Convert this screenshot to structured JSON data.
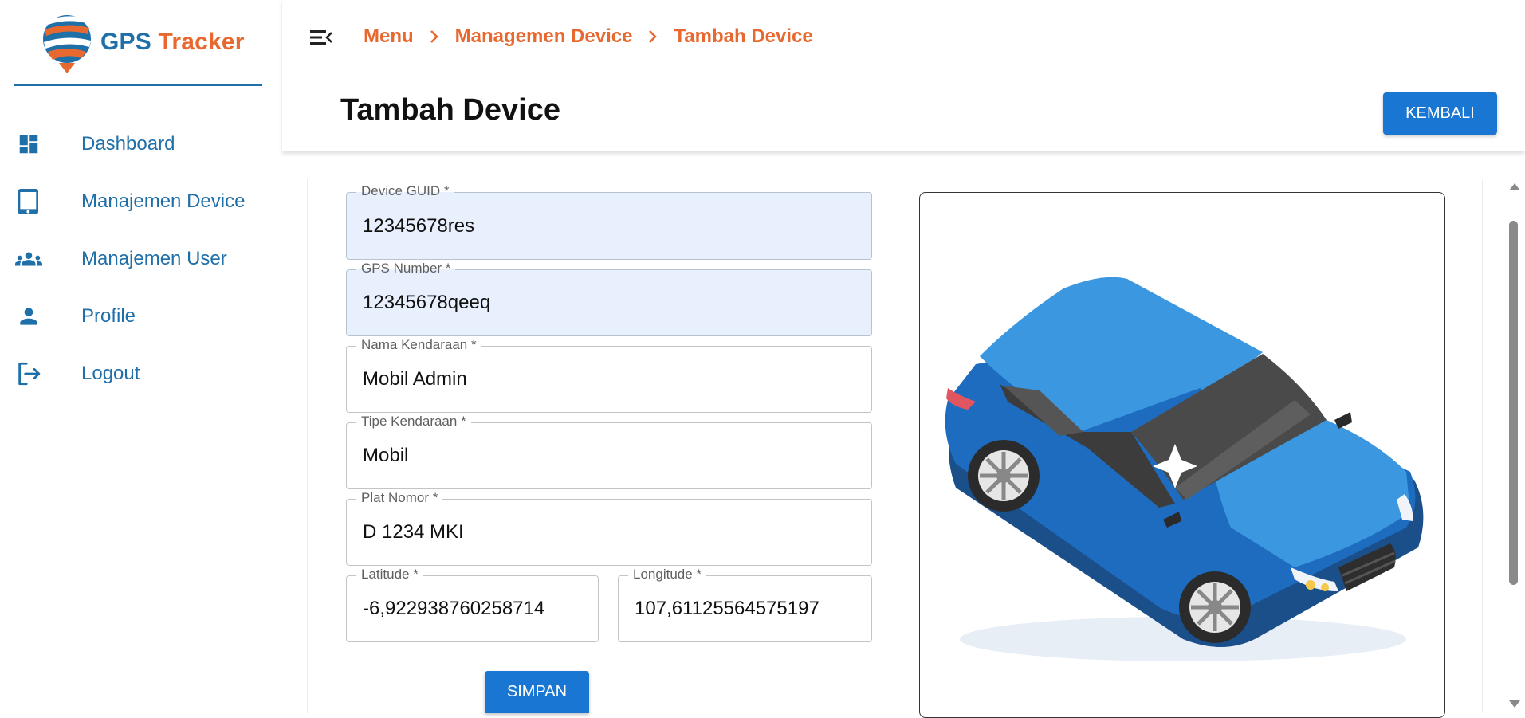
{
  "brand": {
    "name_part1": "GPS",
    "name_part2": "Tracker",
    "primary_color": "#1f6fa8",
    "accent_color": "#e8692f"
  },
  "sidebar": {
    "items": [
      {
        "label": "Dashboard",
        "icon": "dashboard-icon"
      },
      {
        "label": "Manajemen Device",
        "icon": "tablet-icon"
      },
      {
        "label": "Manajemen User",
        "icon": "group-icon"
      },
      {
        "label": "Profile",
        "icon": "person-icon"
      },
      {
        "label": "Logout",
        "icon": "logout-icon"
      }
    ]
  },
  "header": {
    "breadcrumb": [
      "Menu",
      "Managemen Device",
      "Tambah Device"
    ],
    "title": "Tambah Device",
    "back_button": "KEMBALI"
  },
  "form": {
    "device_guid": {
      "label": "Device GUID *",
      "value": "12345678res"
    },
    "gps_number": {
      "label": "GPS Number *",
      "value": "12345678qeeq"
    },
    "vehicle_name": {
      "label": "Nama Kendaraan *",
      "value": "Mobil Admin"
    },
    "vehicle_type": {
      "label": "Tipe Kendaraan *",
      "value": "Mobil"
    },
    "plate_number": {
      "label": "Plat Nomor *",
      "value": "D 1234 MKI"
    },
    "latitude": {
      "label": "Latitude *",
      "value": "-6,922938760258714"
    },
    "longitude": {
      "label": "Longitude *",
      "value": "107,61125564575197"
    },
    "save_button": "SIMPAN"
  },
  "preview": {
    "icon": "car-illustration",
    "car_color": "#2f86d6"
  }
}
